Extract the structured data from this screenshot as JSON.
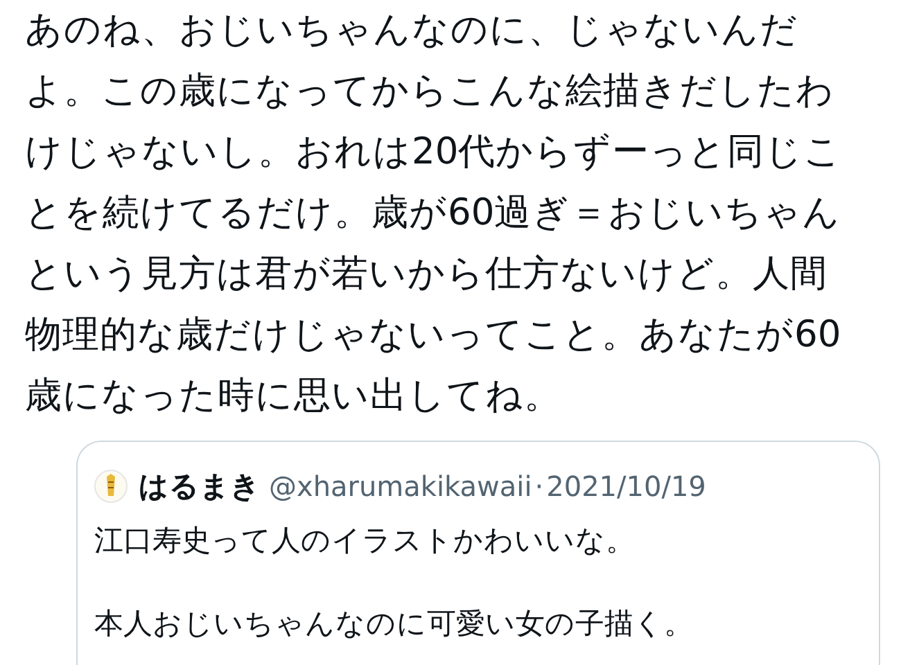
{
  "tweet": {
    "text": "あのね、おじいちゃんなのに、じゃないんだよ。この歳になってからこんな絵描きだしたわけじゃないし。おれは20代からずーっと同じことを続けてるだけ。歳が60過ぎ＝おじいちゃんという見方は君が若いから仕方ないけど。人間物理的な歳だけじゃないってこと。あなたが60歳になった時に思い出してね。"
  },
  "quoted_tweet": {
    "name": "はるまき",
    "handle": "@xharumakikawaii",
    "separator": "·",
    "date": "2021/10/19",
    "paragraphs": [
      "江口寿史って人のイラストかわいいな。",
      "本人おじいちゃんなのに可愛い女の子描く。"
    ]
  }
}
